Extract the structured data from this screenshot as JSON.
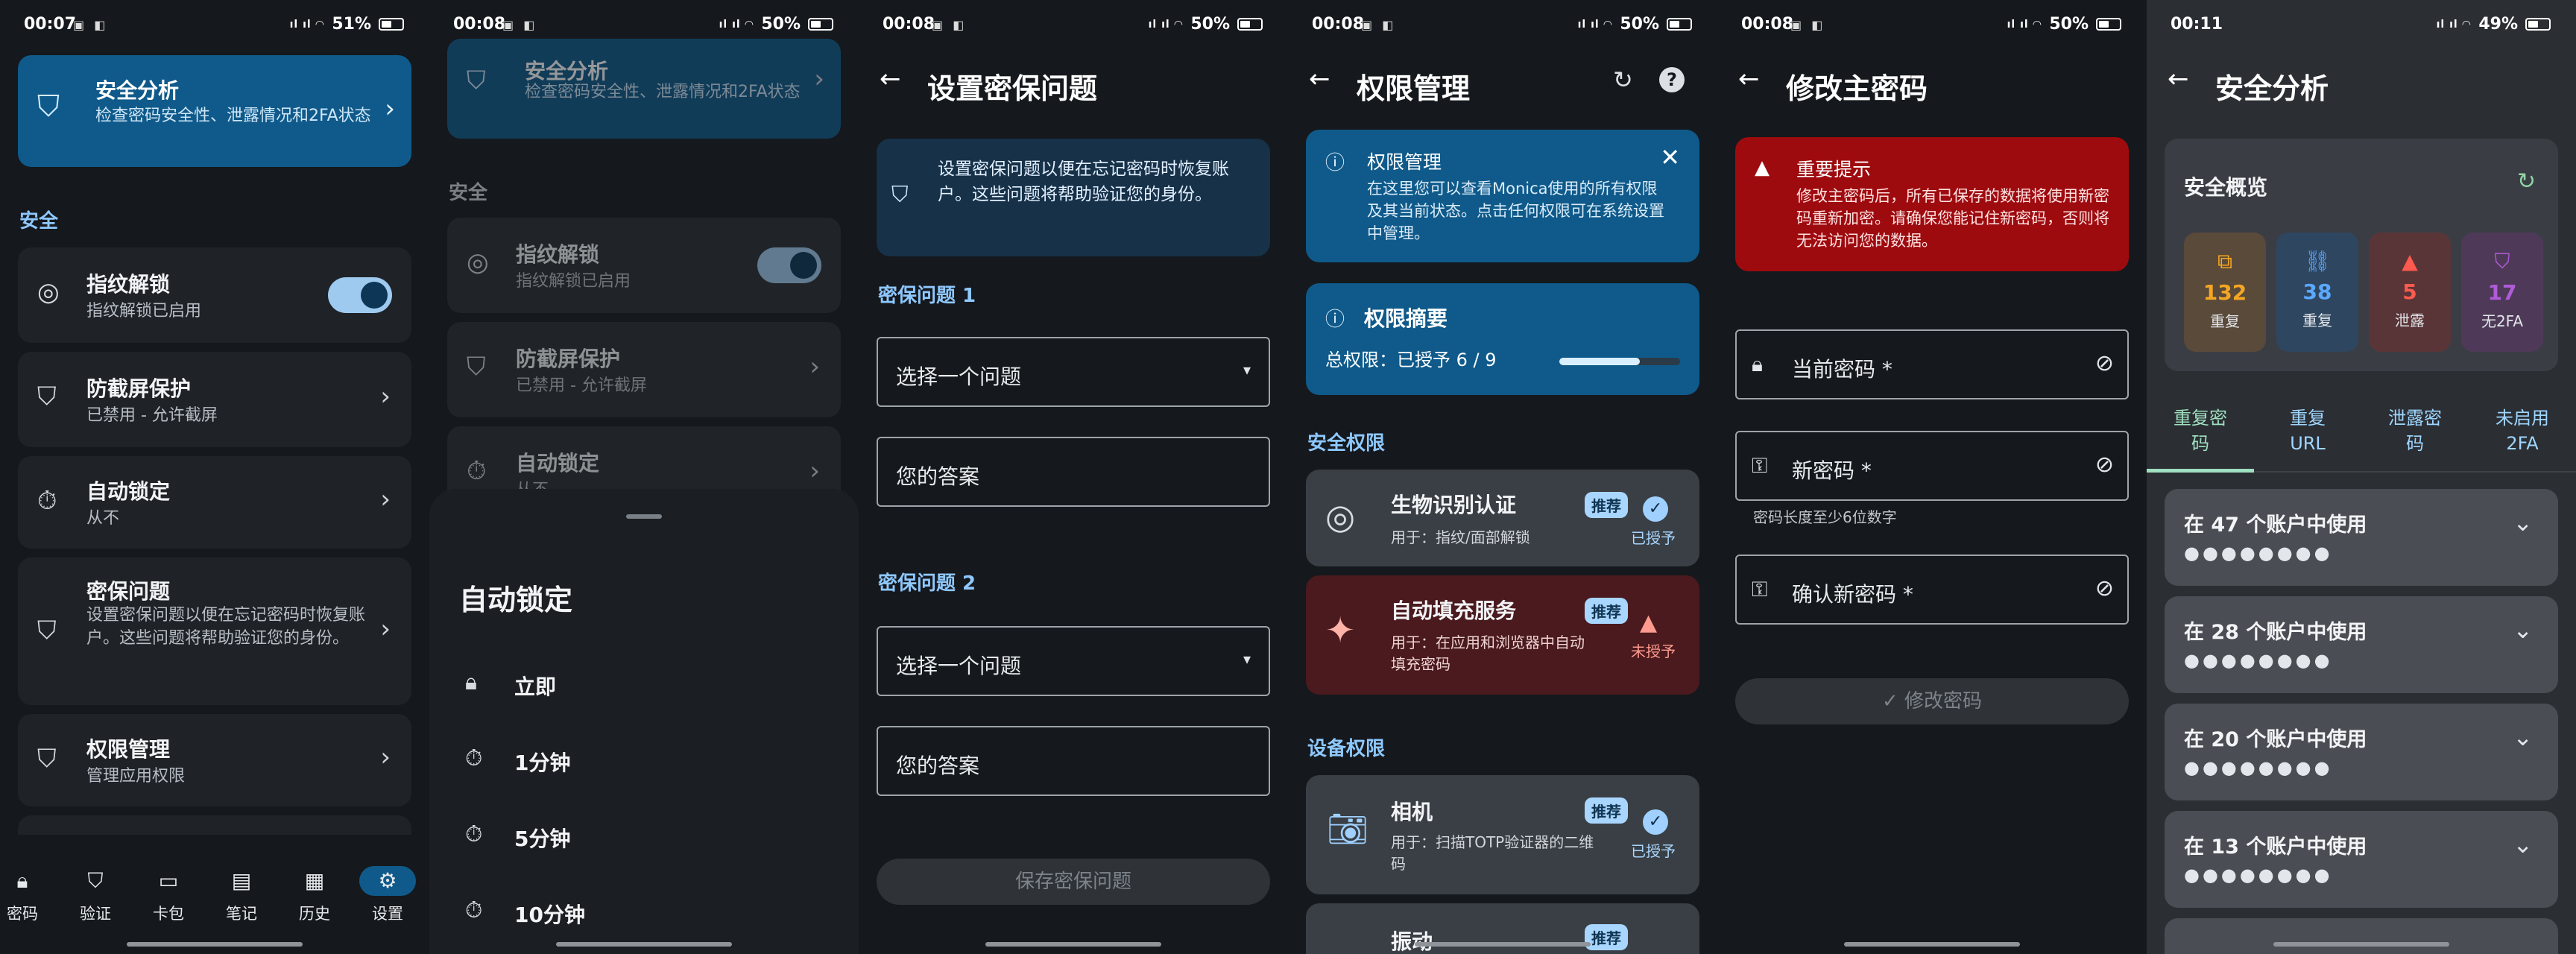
{
  "screens": {
    "s1": {
      "time": "00:07",
      "battery": "51%",
      "battery_level": 0.51,
      "top_card": {
        "title": "安全分析",
        "sub": "检查密码安全性、泄露情况和2FA状态"
      },
      "section": "安全",
      "items": [
        {
          "title": "指纹解锁",
          "sub": "指纹解锁已启用"
        },
        {
          "title": "防截屏保护",
          "sub": "已禁用 - 允许截屏"
        },
        {
          "title": "自动锁定",
          "sub": "从不"
        },
        {
          "title": "密保问题",
          "sub": "设置密保问题以便在忘记密码时恢复账户。这些问题将帮助验证您的身份。"
        },
        {
          "title": "权限管理",
          "sub": "管理应用权限"
        }
      ],
      "fingerprint_toggle_on": true,
      "nav": [
        "密码",
        "验证",
        "卡包",
        "笔记",
        "历史",
        "设置"
      ],
      "nav_active": 5
    },
    "s2": {
      "time": "00:08",
      "battery": "50%",
      "battery_level": 0.5,
      "top_card": {
        "title": "安全分析",
        "sub": "检查密码安全性、泄露情况和2FA状态"
      },
      "section": "安全",
      "items": [
        {
          "title": "指纹解锁",
          "sub": "指纹解锁已启用"
        },
        {
          "title": "防截屏保护",
          "sub": "已禁用 - 允许截屏"
        },
        {
          "title": "自动锁定",
          "sub": "从不"
        }
      ],
      "sheet": {
        "title": "自动锁定",
        "options": [
          "立即",
          "1分钟",
          "5分钟",
          "10分钟"
        ]
      }
    },
    "s3": {
      "time": "00:08",
      "battery": "50%",
      "battery_level": 0.5,
      "title": "设置密保问题",
      "info": "设置密保问题以便在忘记密码时恢复账户。这些问题将帮助验证您的身份。",
      "q1_label": "密保问题 1",
      "q2_label": "密保问题 2",
      "select_placeholder": "选择一个问题",
      "answer_placeholder": "您的答案",
      "save": "保存密保问题"
    },
    "s4": {
      "time": "00:08",
      "battery": "50%",
      "battery_level": 0.5,
      "title": "权限管理",
      "info_title": "权限管理",
      "info_body": "在这里您可以查看Monica使用的所有权限及其当前状态。点击任何权限可在系统设置中管理。",
      "summary_title": "权限摘要",
      "summary_text": "总权限：已授予 6 / 9",
      "summary_fraction": 0.667,
      "sec_label": "安全权限",
      "perms": [
        {
          "title": "生物识别认证",
          "desc": "用于：指纹/面部解锁",
          "badge": "推荐",
          "status": "已授予",
          "granted": true
        },
        {
          "title": "自动填充服务",
          "desc": "用于：在应用和浏览器中自动填充密码",
          "badge": "推荐",
          "status": "未授予",
          "granted": false
        }
      ],
      "dev_label": "设备权限",
      "dev_perms": [
        {
          "title": "相机",
          "desc": "用于：扫描TOTP验证器的二维码",
          "badge": "推荐",
          "status": "已授予",
          "granted": true
        },
        {
          "title": "振动",
          "badge": "推荐"
        }
      ]
    },
    "s5": {
      "time": "00:08",
      "battery": "50%",
      "battery_level": 0.5,
      "title": "修改主密码",
      "warn_title": "重要提示",
      "warn_body": "修改主密码后，所有已保存的数据将使用新密码重新加密。请确保您能记住新密码，否则将无法访问您的数据。",
      "fields": [
        "当前密码 *",
        "新密码 *",
        "确认新密码 *"
      ],
      "hint": "密码长度至少6位数字",
      "submit": "修改密码"
    },
    "s6": {
      "time": "00:11",
      "battery": "49%",
      "battery_level": 0.49,
      "title": "安全分析",
      "overview": "安全概览",
      "stats": [
        {
          "value": "132",
          "label": "重复",
          "color": "#f5a623"
        },
        {
          "value": "38",
          "label": "重复",
          "color": "#5aa8ff"
        },
        {
          "value": "5",
          "label": "泄露",
          "color": "#ff5a4e"
        },
        {
          "value": "17",
          "label": "无2FA",
          "color": "#b05bd8"
        }
      ],
      "tabs": [
        "重复密码",
        "重复URL",
        "泄露密码",
        "未启用2FA"
      ],
      "active_tab": 0,
      "groups": [
        "在 47 个账户中使用",
        "在 28 个账户中使用",
        "在 20 个账户中使用",
        "在 13 个账户中使用"
      ],
      "mask": "●●●●●●●●"
    }
  }
}
